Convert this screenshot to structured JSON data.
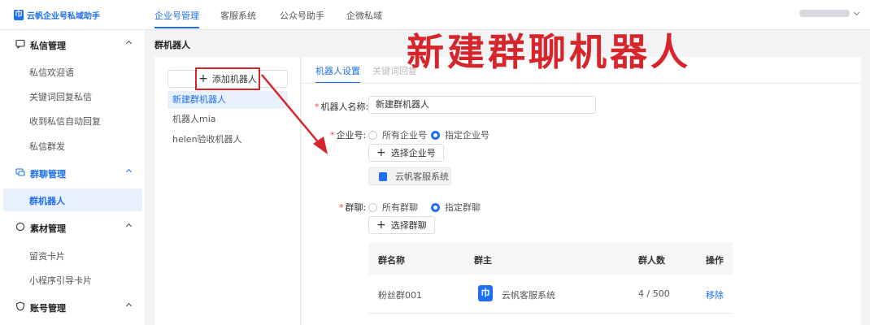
{
  "app": {
    "title": "云帆企业号私域助手"
  },
  "top_tabs": [
    "企业号管理",
    "客服系统",
    "公众号助手",
    "企微私域"
  ],
  "sidebar": {
    "groups": [
      {
        "label": "私信管理",
        "items": [
          "私信欢迎语",
          "关键词回复私信",
          "收到私信自动回复",
          "私信群发"
        ]
      },
      {
        "label": "群聊管理",
        "items": [
          "群机器人"
        ],
        "active_item": "群机器人"
      },
      {
        "label": "素材管理",
        "items": [
          "留资卡片",
          "小程序引导卡片"
        ]
      },
      {
        "label": "账号管理",
        "items": []
      }
    ]
  },
  "page": {
    "title": "群机器人"
  },
  "robot_list": {
    "add_label": "添加机器人",
    "items": [
      "新建群机器人",
      "机器人mia",
      "helen验收机器人"
    ],
    "active_index": 0
  },
  "settings": {
    "tabs": [
      "机器人设置",
      "关键词回复"
    ],
    "name_label": "机器人名称:",
    "name_value": "新建群机器人",
    "corp_label": "企业号:",
    "corp_options": [
      "所有企业号",
      "指定企业号"
    ],
    "corp_selected": "指定企业号",
    "select_corp_label": "选择企业号",
    "selected_corp_tag": "云帆客服系统",
    "group_label": "群聊:",
    "group_options": [
      "所有群聊",
      "指定群聊"
    ],
    "group_selected": "指定群聊",
    "select_group_label": "选择群聊"
  },
  "table": {
    "columns": [
      "群名称",
      "群主",
      "群人数",
      "操作"
    ],
    "rows": [
      {
        "name": "粉丝群001",
        "owner": "云帆客服系统",
        "count": "4 / 500",
        "action": "移除"
      }
    ]
  },
  "annotation": {
    "text": "新建群聊机器人"
  },
  "colors": {
    "accent": "#1e6ff1",
    "annotation_red": "#d6262c"
  },
  "icons": [
    "chat-icon",
    "group-icon",
    "material-icon",
    "shield-icon",
    "plus-icon",
    "chevron-up-icon",
    "chevron-down-icon"
  ]
}
